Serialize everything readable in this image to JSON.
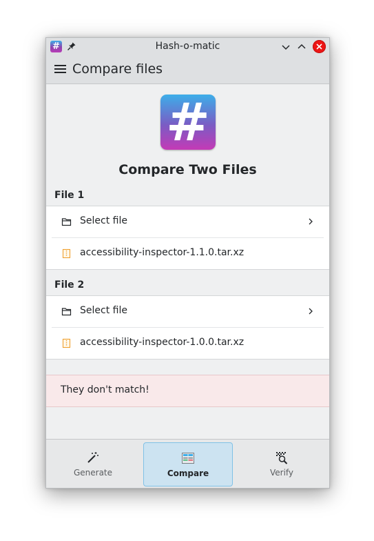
{
  "window": {
    "title": "Hash-o-matic",
    "app_icon_glyph": "#"
  },
  "header": {
    "title": "Compare files"
  },
  "hero": {
    "icon_glyph": "#",
    "heading": "Compare Two Files"
  },
  "file1": {
    "label": "File 1",
    "select_label": "Select file",
    "selected_file": "accessibility-inspector-1.1.0.tar.xz"
  },
  "file2": {
    "label": "File 2",
    "select_label": "Select file",
    "selected_file": "accessibility-inspector-1.0.0.tar.xz"
  },
  "result": {
    "message": "They don't match!"
  },
  "nav": {
    "items": [
      {
        "label": "Generate",
        "icon": "magic-wand-icon",
        "active": false
      },
      {
        "label": "Compare",
        "icon": "compare-icon",
        "active": true
      },
      {
        "label": "Verify",
        "icon": "verify-icon",
        "active": false
      }
    ]
  },
  "colors": {
    "accent": "#3daee9",
    "close": "#ed1515",
    "mismatch_bg": "#f9e9ea",
    "active_nav_bg": "#cce3f1",
    "archive_icon": "#f0a030"
  }
}
